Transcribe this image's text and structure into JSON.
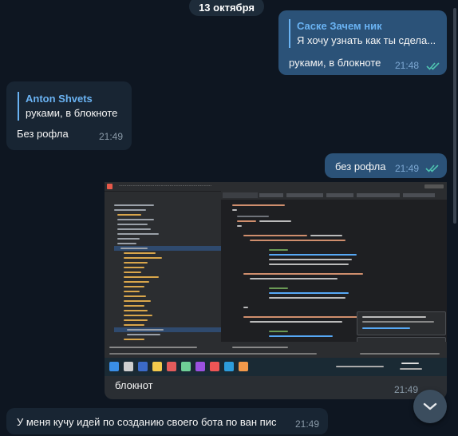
{
  "date_separator": "13 октября",
  "messages": [
    {
      "direction": "outgoing",
      "reply_to": {
        "author": "Саске Зачем ник",
        "preview": "Я хочу узнать как ты сдела..."
      },
      "text": "руками, в блокноте",
      "time": "21:48",
      "status": "read"
    },
    {
      "direction": "incoming",
      "reply_to": {
        "author": "Anton Shvets",
        "preview": "руками, в блокноте"
      },
      "text": "Без рофла",
      "time": "21:49"
    },
    {
      "direction": "outgoing",
      "text": "без рофла",
      "time": "21:49",
      "status": "read"
    },
    {
      "direction": "outgoing",
      "attachment": "ide-screenshot",
      "text": "блокнот",
      "time": "21:49"
    },
    {
      "direction": "incoming",
      "text": "У меня кучу идей по созданию своего бота по ван пис",
      "time": "21:49"
    }
  ],
  "colors": {
    "background": "#0e1621",
    "outgoing_bubble": "#2b5278",
    "incoming_bubble": "#182533",
    "accent": "#6ab3f3",
    "read_check": "#4fc3b0"
  },
  "icons": {
    "scroll_down": "chevron-down-icon",
    "read_receipt": "double-check-icon"
  }
}
